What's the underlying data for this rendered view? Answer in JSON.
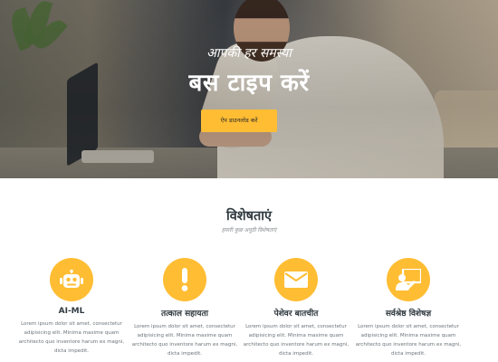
{
  "hero": {
    "subtitle": "आपकी हर समस्या",
    "title": "बस टाइप करें",
    "download_button": "ऐप डाउनलोड करें"
  },
  "features": {
    "title": "विशेषताएं",
    "subtitle": "हमारी कुछ अनूठी विशेषताएं",
    "items": [
      {
        "icon": "robot-icon",
        "title": "AI-ML",
        "description": "Lorem ipsum dolor sit amet, consectetur adipisicing elit. Minima maxime quam architecto quo inventore harum ex magni, dicta impedit."
      },
      {
        "icon": "exclamation-icon",
        "title": "तत्काल सहायता",
        "description": "Lorem ipsum dolor sit amet, consectetur adipisicing elit. Minima maxime quam architecto quo inventore harum ex magni, dicta impedit."
      },
      {
        "icon": "envelope-icon",
        "title": "पेशेवर बातचीत",
        "description": "Lorem ipsum dolor sit amet, consectetur adipisicing elit. Minima maxime quam architecto quo inventore harum ex magni, dicta impedit."
      },
      {
        "icon": "teacher-icon",
        "title": "सर्वश्रेष्ठ विशेषज्ञ",
        "description": "Lorem ipsum dolor sit amet, consectetur adipisicing elit. Minima maxime quam architecto quo inventore harum ex magni, dicta impedit."
      }
    ]
  },
  "colors": {
    "accent": "#ffbd33",
    "heading": "#303a40",
    "body_text": "#6b7378"
  }
}
